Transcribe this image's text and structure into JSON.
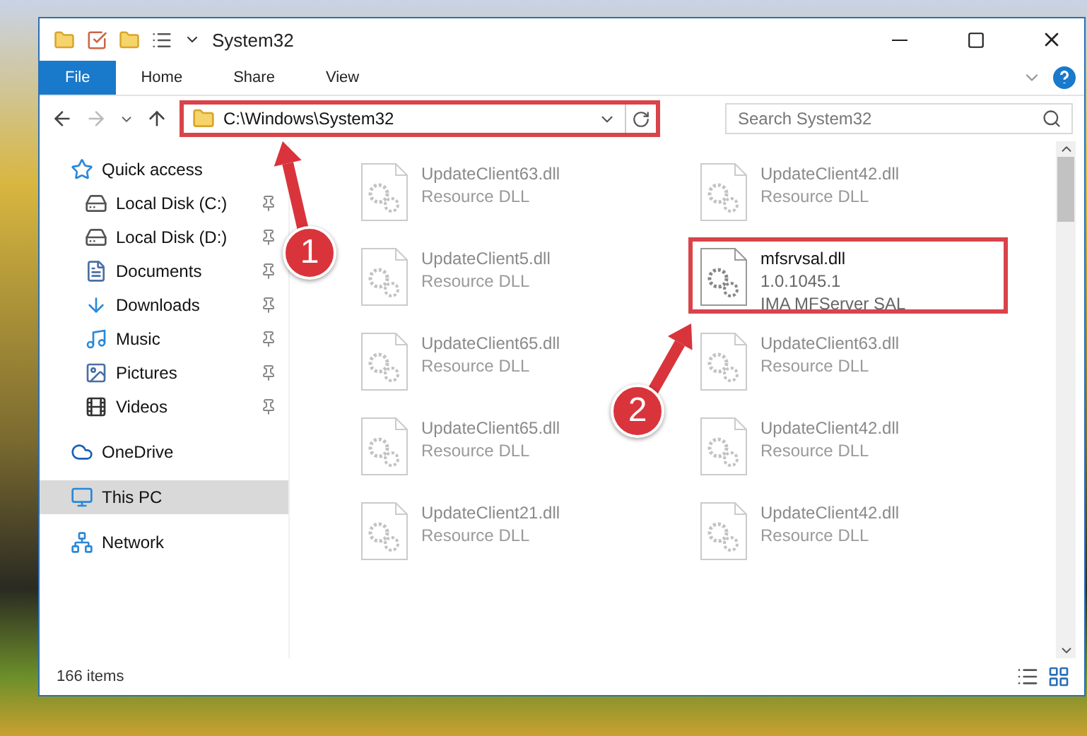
{
  "window": {
    "title": "System32"
  },
  "ribbon_tabs": [
    {
      "label": "File",
      "kind": "file"
    },
    {
      "label": "Home",
      "kind": "tab",
      "selected": false
    },
    {
      "label": "Share",
      "kind": "tab",
      "selected": false
    },
    {
      "label": "View",
      "kind": "tab",
      "selected": false
    }
  ],
  "address_bar": {
    "path": "C:\\Windows\\System32",
    "highlighted": true
  },
  "search": {
    "placeholder": "Search System32"
  },
  "sidebar": {
    "items": [
      {
        "label": "Quick access",
        "kind": "quick",
        "pinned": false,
        "selected": false
      },
      {
        "label": "Local Disk (C:)",
        "kind": "system-drive",
        "pinned": true,
        "selected": false
      },
      {
        "label": "Local Disk (D:)",
        "kind": "drive",
        "pinned": true,
        "selected": false
      },
      {
        "label": "Documents",
        "kind": "documents",
        "pinned": true,
        "selected": false
      },
      {
        "label": "Downloads",
        "kind": "downloads",
        "pinned": true,
        "selected": false
      },
      {
        "label": "Music",
        "kind": "music",
        "pinned": true,
        "selected": false
      },
      {
        "label": "Pictures",
        "kind": "pictures",
        "pinned": true,
        "selected": false
      },
      {
        "label": "Videos",
        "kind": "videos",
        "pinned": true,
        "selected": false
      },
      {
        "label": "OneDrive",
        "kind": "cloud",
        "pinned": false,
        "selected": false
      },
      {
        "label": "This PC",
        "kind": "pc",
        "pinned": false,
        "selected": true
      },
      {
        "label": "Network",
        "kind": "network",
        "pinned": false,
        "selected": false
      }
    ]
  },
  "files": [
    {
      "name": "UpdateClient63.dll",
      "details": [
        "Resource DLL"
      ],
      "faded": true,
      "highlighted": false
    },
    {
      "name": "UpdateClient42.dll",
      "details": [
        "Resource DLL"
      ],
      "faded": true,
      "highlighted": false
    },
    {
      "name": "UpdateClient5.dll",
      "details": [
        "Resource DLL"
      ],
      "faded": true,
      "highlighted": false
    },
    {
      "name": "mfsrvsal.dll",
      "details": [
        "1.0.1045.1",
        "IMA MFServer SAL"
      ],
      "faded": false,
      "highlighted": true
    },
    {
      "name": "UpdateClient65.dll",
      "details": [
        "Resource DLL"
      ],
      "faded": true,
      "highlighted": false
    },
    {
      "name": "UpdateClient63.dll",
      "details": [
        "Resource DLL"
      ],
      "faded": true,
      "highlighted": false
    },
    {
      "name": "UpdateClient65.dll",
      "details": [
        "Resource DLL"
      ],
      "faded": true,
      "highlighted": false
    },
    {
      "name": "UpdateClient42.dll",
      "details": [
        "Resource DLL"
      ],
      "faded": true,
      "highlighted": false
    },
    {
      "name": "UpdateClient21.dll",
      "details": [
        "Resource DLL"
      ],
      "faded": true,
      "highlighted": false
    },
    {
      "name": "UpdateClient42.dll",
      "details": [
        "Resource DLL"
      ],
      "faded": true,
      "highlighted": false
    }
  ],
  "status_bar": {
    "item_count": "166 items"
  },
  "callouts": [
    {
      "label": "1"
    },
    {
      "label": "2"
    }
  ]
}
